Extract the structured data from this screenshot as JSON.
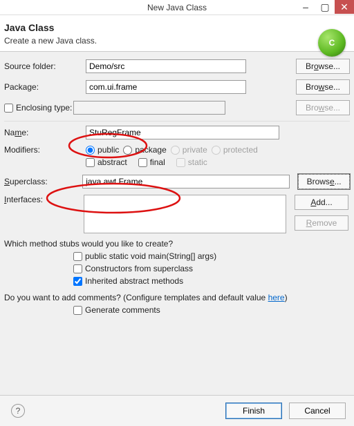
{
  "window": {
    "title": "New Java Class",
    "minimize": "–",
    "maximize": "▢",
    "close": "✕"
  },
  "header": {
    "title": "Java Class",
    "subtitle": "Create a new Java class.",
    "icon_letter": "C"
  },
  "labels": {
    "source_folder": "Source folder:",
    "package": "Package:",
    "enclosing_type": "Enclosing type:",
    "name": "Name:",
    "modifiers": "Modifiers:",
    "superclass": "Superclass:",
    "interfaces": "Interfaces:",
    "method_q": "Which method stubs would you like to create?",
    "comments_q_prefix": "Do you want to add comments? (Configure templates and default value ",
    "comments_q_link": "here",
    "comments_q_suffix": ")"
  },
  "fields": {
    "source_folder": "Demo/src",
    "package": "com.ui.frame",
    "enclosing_type": "",
    "name": "StuRegFrame",
    "superclass": "java.awt.Frame"
  },
  "modifiers": {
    "public": "public",
    "package": "package",
    "private": "private",
    "protected": "protected",
    "abstract": "abstract",
    "final": "final",
    "static": "static"
  },
  "method_stubs": {
    "main": "public static void main(String[] args)",
    "constructors": "Constructors from superclass",
    "inherited": "Inherited abstract methods"
  },
  "comments": {
    "generate": "Generate comments"
  },
  "buttons": {
    "browse": "Browse...",
    "add": "Add...",
    "remove": "Remove",
    "finish": "Finish",
    "cancel": "Cancel",
    "help": "?"
  }
}
